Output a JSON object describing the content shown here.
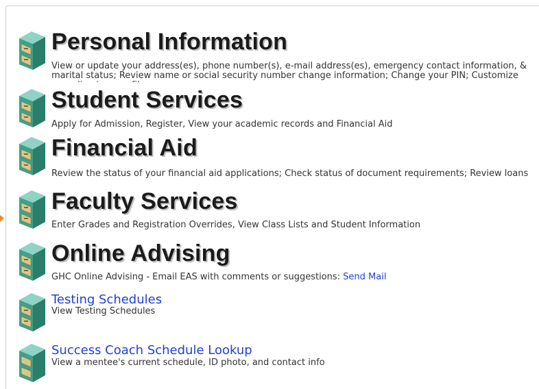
{
  "menu": {
    "items": [
      {
        "title": "Personal Information",
        "description": "View or update your address(es), phone number(s), e-mail address(es), emergency contact information, & marital status; Review name or social security number change information; Change your PIN; Customize your directory profile ."
      },
      {
        "title": "Student Services",
        "description": "Apply for Admission, Register, View your academic records and Financial Aid"
      },
      {
        "title": "Financial Aid",
        "description": "Review the status of your financial aid applications; Check status of document requirements; Review loans"
      },
      {
        "title": "Faculty Services",
        "description": "Enter Grades and Registration Overrides, View Class Lists and Student Information"
      },
      {
        "title": "Online Advising",
        "description": "GHC Online Advising - Email EAS with comments or suggestions:",
        "link_label": "Send Mail"
      },
      {
        "title": "Testing Schedules",
        "description": "View Testing Schedules"
      },
      {
        "title": "Success Coach Schedule Lookup",
        "description": "View a mentee's current schedule, ID photo, and contact info"
      }
    ]
  },
  "colors": {
    "link": "#1f3fd6",
    "heading_text": "#1b1b1b",
    "heading_shadow": "#bfbfbf",
    "cabinet_teal": "#3fa08c",
    "cabinet_drawer": "#d8c98a"
  }
}
